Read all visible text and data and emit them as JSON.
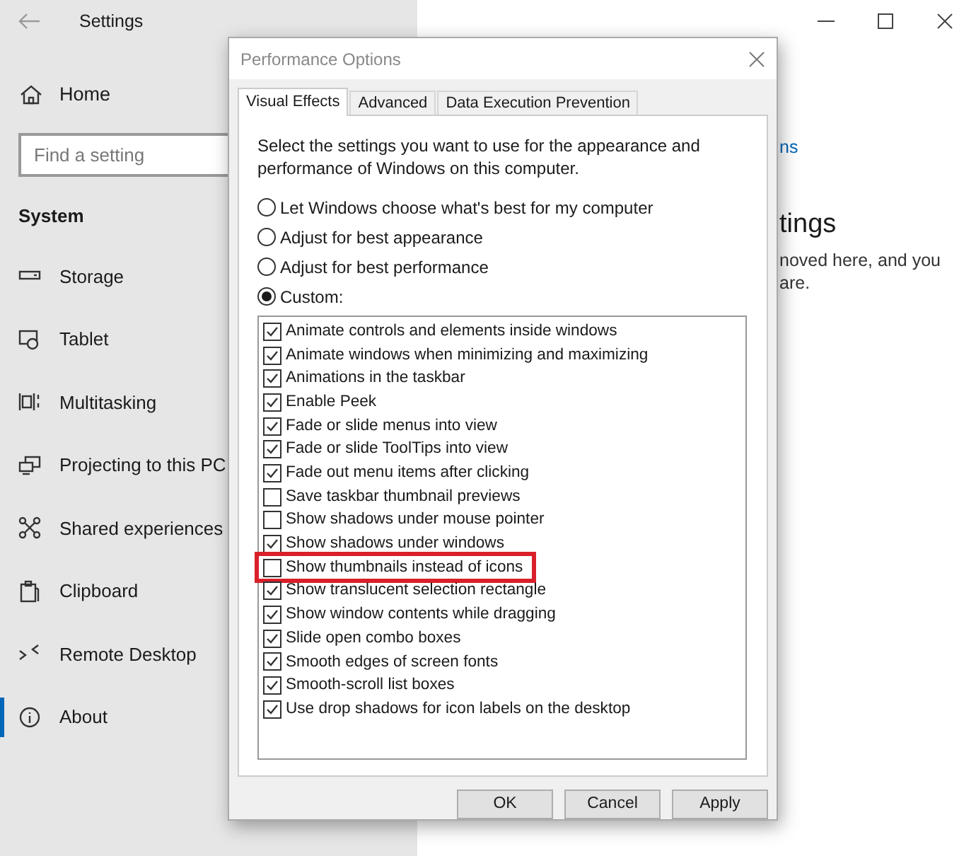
{
  "settings_window": {
    "title": "Settings",
    "sidebar": {
      "home": "Home",
      "search": {
        "placeholder": "Find a setting"
      },
      "section": "System",
      "items": [
        {
          "label": "Storage",
          "selected": false
        },
        {
          "label": "Tablet",
          "selected": false
        },
        {
          "label": "Multitasking",
          "selected": false
        },
        {
          "label": "Projecting to this PC",
          "selected": false
        },
        {
          "label": "Shared experiences",
          "selected": false
        },
        {
          "label": "Clipboard",
          "selected": false
        },
        {
          "label": "Remote Desktop",
          "selected": false
        },
        {
          "label": "About",
          "selected": true
        }
      ]
    },
    "content": {
      "link": "ns",
      "heading": "tings",
      "text_lines": [
        "noved here, and you",
        "are."
      ]
    }
  },
  "dialog": {
    "title": "Performance Options",
    "tabs": [
      {
        "label": "Visual Effects",
        "selected": true
      },
      {
        "label": "Advanced",
        "selected": false
      },
      {
        "label": "Data Execution Prevention",
        "selected": false
      }
    ],
    "description": "Select the settings you want to use for the appearance and performance of Windows on this computer.",
    "radios": [
      {
        "label": "Let Windows choose what's best for my computer",
        "selected": false
      },
      {
        "label": "Adjust for best appearance",
        "selected": false
      },
      {
        "label": "Adjust for best performance",
        "selected": false
      },
      {
        "label": "Custom:",
        "selected": true
      }
    ],
    "effects": [
      {
        "label": "Animate controls and elements inside windows",
        "checked": true,
        "highlighted": false
      },
      {
        "label": "Animate windows when minimizing and maximizing",
        "checked": true,
        "highlighted": false
      },
      {
        "label": "Animations in the taskbar",
        "checked": true,
        "highlighted": false
      },
      {
        "label": "Enable Peek",
        "checked": true,
        "highlighted": false
      },
      {
        "label": "Fade or slide menus into view",
        "checked": true,
        "highlighted": false
      },
      {
        "label": "Fade or slide ToolTips into view",
        "checked": true,
        "highlighted": false
      },
      {
        "label": "Fade out menu items after clicking",
        "checked": true,
        "highlighted": false
      },
      {
        "label": "Save taskbar thumbnail previews",
        "checked": false,
        "highlighted": false
      },
      {
        "label": "Show shadows under mouse pointer",
        "checked": false,
        "highlighted": false
      },
      {
        "label": "Show shadows under windows",
        "checked": true,
        "highlighted": false
      },
      {
        "label": "Show thumbnails instead of icons",
        "checked": false,
        "highlighted": true
      },
      {
        "label": "Show translucent selection rectangle",
        "checked": true,
        "highlighted": false
      },
      {
        "label": "Show window contents while dragging",
        "checked": true,
        "highlighted": false
      },
      {
        "label": "Slide open combo boxes",
        "checked": true,
        "highlighted": false
      },
      {
        "label": "Smooth edges of screen fonts",
        "checked": true,
        "highlighted": false
      },
      {
        "label": "Smooth-scroll list boxes",
        "checked": true,
        "highlighted": false
      },
      {
        "label": "Use drop shadows for icon labels on the desktop",
        "checked": true,
        "highlighted": false
      }
    ],
    "buttons": [
      "OK",
      "Cancel",
      "Apply"
    ]
  }
}
